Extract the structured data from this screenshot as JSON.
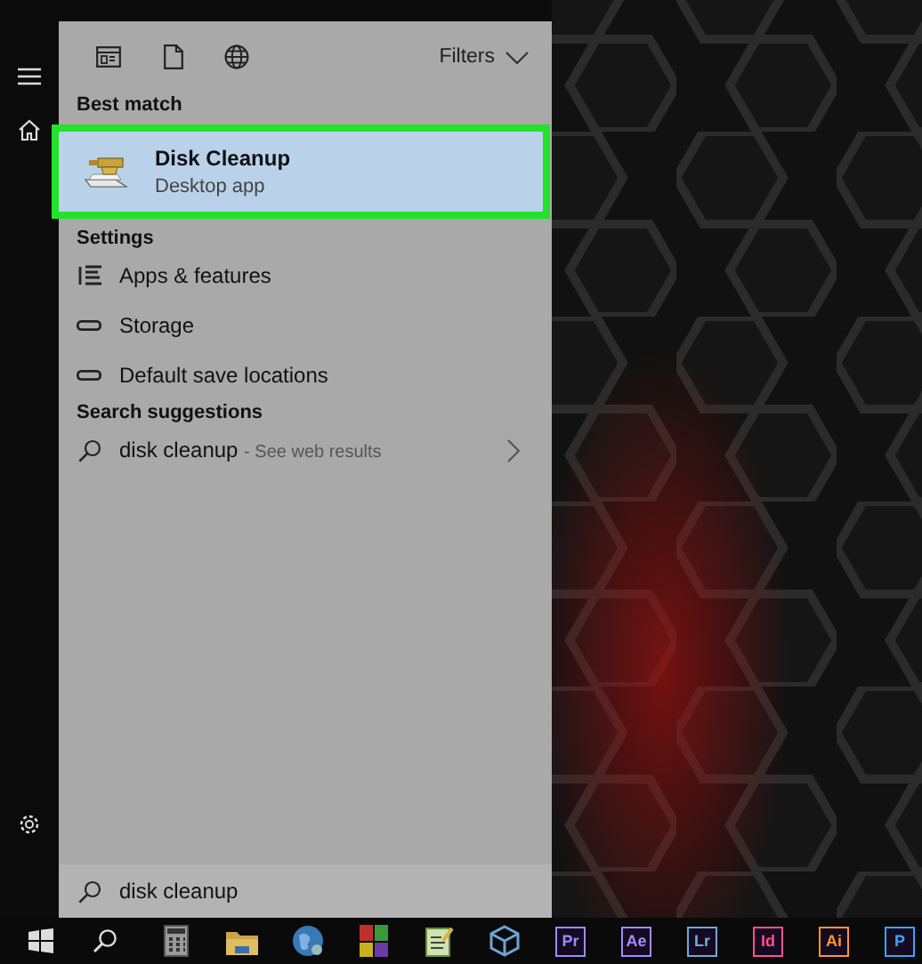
{
  "toolbar": {
    "filters": "Filters"
  },
  "best_match": {
    "heading": "Best match",
    "item": {
      "title": "Disk Cleanup",
      "subtitle": "Desktop app",
      "selected": true
    }
  },
  "settings": {
    "heading": "Settings",
    "items": [
      {
        "label": "Apps & features",
        "kind": "list"
      },
      {
        "label": "Storage",
        "kind": "drive"
      },
      {
        "label": "Default save locations",
        "kind": "drive"
      }
    ]
  },
  "suggestions": {
    "heading": "Search suggestions",
    "items": [
      {
        "query": "disk cleanup",
        "hint": "- See web results"
      }
    ]
  },
  "search": {
    "value": "disk cleanup"
  },
  "taskbar": {
    "apps": [
      {
        "kind": "calculator"
      },
      {
        "kind": "folder"
      },
      {
        "kind": "globe"
      },
      {
        "kind": "tiles"
      },
      {
        "kind": "notepad"
      },
      {
        "kind": "cube"
      },
      {
        "kind": "adobe",
        "label": "Pr",
        "color": "#9a8cff"
      },
      {
        "kind": "adobe",
        "label": "Ae",
        "color": "#a58cff"
      },
      {
        "kind": "adobe",
        "label": "Lr",
        "color": "#6fa8dc"
      },
      {
        "kind": "adobe",
        "label": "Id",
        "color": "#ff4f8b"
      },
      {
        "kind": "adobe",
        "label": "Ai",
        "color": "#ff9a1f"
      },
      {
        "kind": "adobe",
        "label": "P",
        "color": "#31a8ff"
      }
    ]
  }
}
